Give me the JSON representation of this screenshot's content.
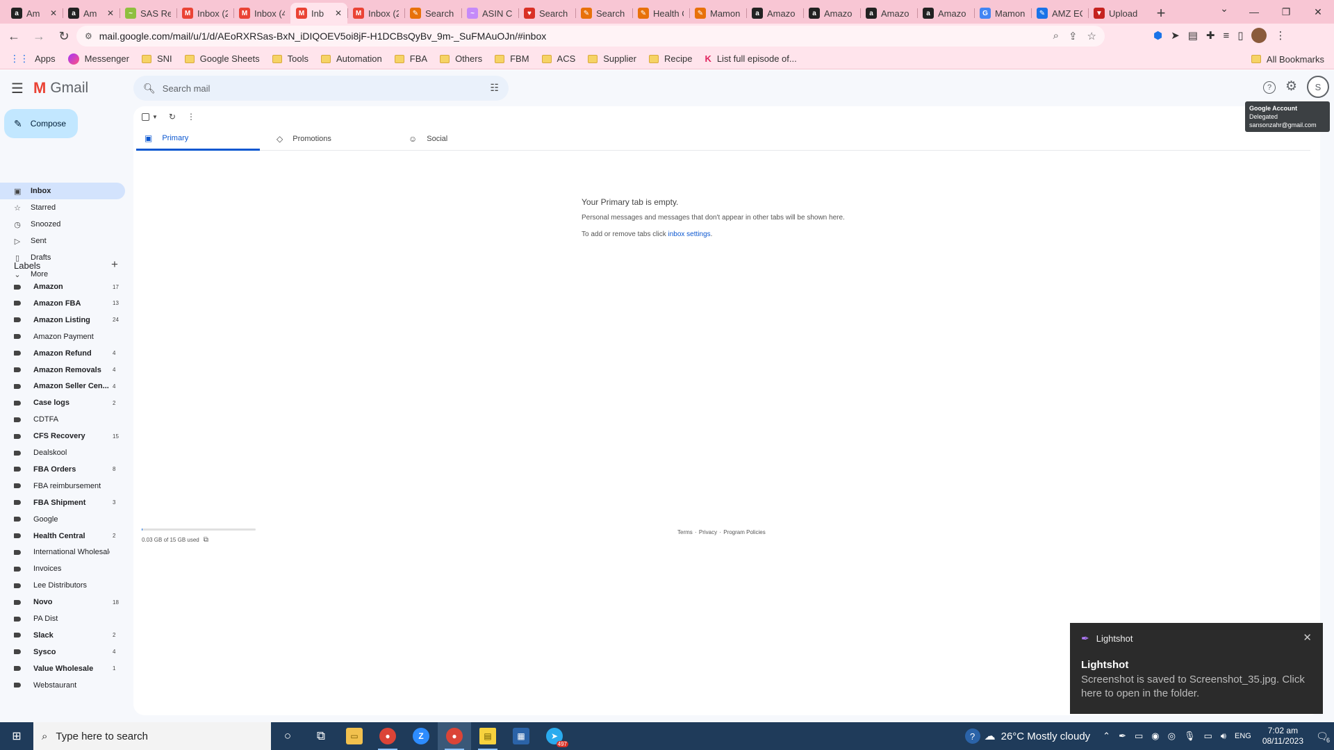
{
  "browser": {
    "tabs": [
      {
        "label": "Am",
        "fav_color": "#222222",
        "fav_glyph": "a"
      },
      {
        "label": "Am",
        "fav_color": "#222222",
        "fav_glyph": "a"
      },
      {
        "label": "SAS Re",
        "fav_color": "#8fbf3f",
        "fav_glyph": "~"
      },
      {
        "label": "Inbox (2",
        "fav_color": "#ea4335",
        "fav_glyph": "M"
      },
      {
        "label": "Inbox (4",
        "fav_color": "#ea4335",
        "fav_glyph": "M"
      },
      {
        "label": "Inb",
        "fav_color": "#ea4335",
        "fav_glyph": "M"
      },
      {
        "label": "Inbox (2",
        "fav_color": "#ea4335",
        "fav_glyph": "M"
      },
      {
        "label": "Search",
        "fav_color": "#e8710a",
        "fav_glyph": "✎"
      },
      {
        "label": "ASIN C",
        "fav_color": "#c58af9",
        "fav_glyph": "~"
      },
      {
        "label": "Search",
        "fav_color": "#d93025",
        "fav_glyph": "♥"
      },
      {
        "label": "Search",
        "fav_color": "#e8710a",
        "fav_glyph": "✎"
      },
      {
        "label": "Health C",
        "fav_color": "#e8710a",
        "fav_glyph": "✎"
      },
      {
        "label": "Mamon",
        "fav_color": "#e8710a",
        "fav_glyph": "✎"
      },
      {
        "label": "Amazo",
        "fav_color": "#222222",
        "fav_glyph": "a"
      },
      {
        "label": "Amazo",
        "fav_color": "#222222",
        "fav_glyph": "a"
      },
      {
        "label": "Amazo",
        "fav_color": "#222222",
        "fav_glyph": "a"
      },
      {
        "label": "Amazo",
        "fav_color": "#222222",
        "fav_glyph": "a"
      },
      {
        "label": "Mamon",
        "fav_color": "#4285f4",
        "fav_glyph": "G"
      },
      {
        "label": "AMZ EC",
        "fav_color": "#1a73e8",
        "fav_glyph": "✎"
      },
      {
        "label": "Upload",
        "fav_color": "#c5221f",
        "fav_glyph": "▼"
      }
    ],
    "active_tab_index": 5,
    "url": "mail.google.com/mail/u/1/d/AEoRXRSas-BxN_iDIQOEV5oi8jF-H1DCBsQyBv_9m-_SuFMAuOJn/#inbox",
    "bookmarks": [
      "Apps",
      "Messenger",
      "SNI",
      "Google Sheets",
      "Tools",
      "Automation",
      "FBA",
      "Others",
      "FBM",
      "ACS",
      "Supplier",
      "Recipe",
      "List full episode of..."
    ],
    "all_bookmarks": "All Bookmarks"
  },
  "gmail": {
    "brand": "Gmail",
    "search_placeholder": "Search mail",
    "compose": "Compose",
    "nav": [
      {
        "label": "Inbox",
        "icon": "inbox-icon",
        "active": true
      },
      {
        "label": "Starred",
        "icon": "star-icon"
      },
      {
        "label": "Snoozed",
        "icon": "clock-icon"
      },
      {
        "label": "Sent",
        "icon": "send-icon"
      },
      {
        "label": "Drafts",
        "icon": "draft-icon"
      },
      {
        "label": "More",
        "icon": "chevron-down-icon"
      }
    ],
    "labels_heading": "Labels",
    "labels": [
      {
        "name": "Amazon",
        "count": "17",
        "bold": true
      },
      {
        "name": "Amazon FBA",
        "count": "13",
        "bold": true
      },
      {
        "name": "Amazon Listing",
        "count": "24",
        "bold": true
      },
      {
        "name": "Amazon Payment",
        "count": "",
        "bold": false
      },
      {
        "name": "Amazon Refund",
        "count": "4",
        "bold": true
      },
      {
        "name": "Amazon Removals",
        "count": "4",
        "bold": true
      },
      {
        "name": "Amazon Seller Cen...",
        "count": "4",
        "bold": true
      },
      {
        "name": "Case logs",
        "count": "2",
        "bold": true
      },
      {
        "name": "CDTFA",
        "count": "",
        "bold": false
      },
      {
        "name": "CFS Recovery",
        "count": "15",
        "bold": true
      },
      {
        "name": "Dealskool",
        "count": "",
        "bold": false
      },
      {
        "name": "FBA Orders",
        "count": "8",
        "bold": true
      },
      {
        "name": "FBA reimbursement",
        "count": "",
        "bold": false
      },
      {
        "name": "FBA Shipment",
        "count": "3",
        "bold": true
      },
      {
        "name": "Google",
        "count": "",
        "bold": false
      },
      {
        "name": "Health Central",
        "count": "2",
        "bold": true
      },
      {
        "name": "International Wholesale",
        "count": "",
        "bold": false
      },
      {
        "name": "Invoices",
        "count": "",
        "bold": false
      },
      {
        "name": "Lee Distributors",
        "count": "",
        "bold": false
      },
      {
        "name": "Novo",
        "count": "18",
        "bold": true
      },
      {
        "name": "PA Dist",
        "count": "",
        "bold": false
      },
      {
        "name": "Slack",
        "count": "2",
        "bold": true
      },
      {
        "name": "Sysco",
        "count": "4",
        "bold": true
      },
      {
        "name": "Value Wholesale",
        "count": "1",
        "bold": true
      },
      {
        "name": "Webstaurant",
        "count": "",
        "bold": false
      }
    ],
    "category_tabs": [
      {
        "label": "Primary",
        "icon": "inbox-icon",
        "active": true
      },
      {
        "label": "Promotions",
        "icon": "tag-icon"
      },
      {
        "label": "Social",
        "icon": "people-icon"
      }
    ],
    "empty": {
      "title": "Your Primary tab is empty.",
      "description": "Personal messages and messages that don't appear in other tabs will be shown here.",
      "hint_prefix": "To add or remove tabs click ",
      "hint_link": "inbox settings",
      "hint_suffix": "."
    },
    "storage": {
      "text": "0.03 GB of 15 GB used",
      "used_fraction": 0.002
    },
    "footer": {
      "terms": "Terms",
      "sep": " · ",
      "privacy": "Privacy",
      "policies": "Program Policies"
    },
    "account": {
      "initial": "S",
      "tooltip_title": "Google Account",
      "tooltip_status": "Delegated",
      "tooltip_email": "sansonzahr@gmail.com"
    }
  },
  "toast": {
    "app": "Lightshot",
    "title": "Lightshot",
    "body": "Screenshot is saved to Screenshot_35.jpg. Click here to open in the folder."
  },
  "taskbar": {
    "search_placeholder": "Type here to search",
    "weather": "26°C  Mostly cloudy",
    "language": "ENG",
    "time": "7:02 am",
    "date": "08/11/2023",
    "telegram_badge": "497",
    "notifications": "6"
  },
  "colors": {
    "tab_strip": "#f8c6d4",
    "toolbar": "#ffe4ec",
    "compose": "#c2e7ff",
    "active_nav": "#d3e3fd",
    "accent": "#0b57d0",
    "taskbar": "#1f3b5a"
  }
}
